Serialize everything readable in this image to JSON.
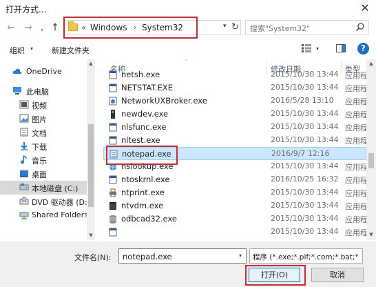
{
  "window": {
    "title": "打开方式..."
  },
  "nav": {
    "back": "←",
    "forward": "→",
    "up": "↑",
    "breadcrumb_prefix": "«",
    "breadcrumb": [
      "Windows",
      "System32"
    ],
    "crumb_arrow": "›",
    "refresh": "↻",
    "dropdown": "▾",
    "search_placeholder": "搜索\"System32\""
  },
  "toolbar": {
    "organize": "组织",
    "organize_chev": "▾",
    "new_folder": "新建文件夹",
    "view_chev": "▾",
    "help": "?"
  },
  "sidebar": {
    "items": [
      {
        "label": "OneDrive",
        "icon": "cloud-icon",
        "selected": false
      },
      {
        "label": "此电脑",
        "icon": "computer-icon",
        "selected": false
      },
      {
        "label": "视频",
        "icon": "video-folder-icon",
        "selected": false
      },
      {
        "label": "图片",
        "icon": "pictures-folder-icon",
        "selected": false
      },
      {
        "label": "文档",
        "icon": "documents-folder-icon",
        "selected": false
      },
      {
        "label": "下载",
        "icon": "download-icon",
        "selected": false
      },
      {
        "label": "音乐",
        "icon": "music-icon",
        "selected": false
      },
      {
        "label": "桌面",
        "icon": "desktop-icon",
        "selected": false
      },
      {
        "label": "本地磁盘 (C:)",
        "icon": "drive-icon",
        "selected": true
      },
      {
        "label": "DVD 驱动器 (D:",
        "icon": "dvd-icon",
        "selected": false
      },
      {
        "label": "Shared Folders",
        "icon": "network-drive-icon",
        "selected": false
      }
    ]
  },
  "filelist": {
    "columns": {
      "name": "名称",
      "date": "修改日期",
      "type": "类型"
    },
    "rows": [
      {
        "name": "netsh.exe",
        "date": "2015/10/30 13:44",
        "type": "应用程",
        "icon": "exe-icon"
      },
      {
        "name": "NETSTAT.EXE",
        "date": "2015/10/30 13:44",
        "type": "应用程",
        "icon": "exe-icon"
      },
      {
        "name": "NetworkUXBroker.exe",
        "date": "2016/5/28 13:10",
        "type": "应用程",
        "icon": "network-icon"
      },
      {
        "name": "newdev.exe",
        "date": "2015/10/30 13:44",
        "type": "应用程",
        "icon": "device-icon"
      },
      {
        "name": "nlsfunc.exe",
        "date": "2015/10/30 13:44",
        "type": "应用程",
        "icon": "exe-icon"
      },
      {
        "name": "nltest.exe",
        "date": "2015/10/30 13:44",
        "type": "应用程",
        "icon": "exe-icon"
      },
      {
        "name": "notepad.exe",
        "date": "2016/9/7 12:16",
        "type": "",
        "icon": "notepad-icon",
        "selected": true
      },
      {
        "name": "nslookup.exe",
        "date": "2015/10/30 13:44",
        "type": "应用程",
        "icon": "globe-icon"
      },
      {
        "name": "ntoskrnl.exe",
        "date": "2016/10/25 16:32",
        "type": "应用程",
        "icon": "exe-icon"
      },
      {
        "name": "ntprint.exe",
        "date": "2015/10/30 13:44",
        "type": "应用程",
        "icon": "printer-icon"
      },
      {
        "name": "ntvdm.exe",
        "date": "2015/10/30 13:44",
        "type": "应用程",
        "icon": "window-icon"
      },
      {
        "name": "odbcad32.exe",
        "date": "2015/10/30 13:44",
        "type": "应用程",
        "icon": "database-icon"
      },
      {
        "name": "",
        "date": "2015/10/30 13:44",
        "type": "应用程",
        "icon": "exe-icon"
      }
    ]
  },
  "bottom": {
    "filename_label": "文件名(N):",
    "filename_value": "notepad.exe",
    "filter_value": "程序 (*.exe;*.pif;*.com;*.bat;*.",
    "open_label": "打开(O)",
    "cancel_label": "取消"
  },
  "colors": {
    "highlight_red": "#e0242a",
    "selection_blue": "#cce8ff",
    "accent": "#0078d7"
  }
}
